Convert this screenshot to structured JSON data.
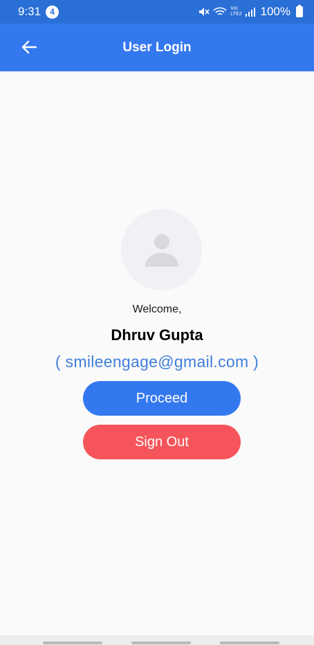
{
  "status_bar": {
    "time": "9:31",
    "notification_count": "4",
    "battery": "100%",
    "network_label_top": "Vo)",
    "network_label_bottom": "LTE2"
  },
  "app_bar": {
    "title": "User Login",
    "back_icon": "arrow-left-icon"
  },
  "profile": {
    "avatar_icon": "person-icon",
    "welcome": "Welcome,",
    "name": "Dhruv Gupta",
    "email": "( smileengage@gmail.com )"
  },
  "actions": {
    "proceed_label": "Proceed",
    "signout_label": "Sign Out"
  },
  "colors": {
    "primary": "#3478f0",
    "status_bar": "#2a6fd6",
    "danger": "#f5555a",
    "email_text": "#3f7fd9",
    "background": "#fafafa"
  }
}
